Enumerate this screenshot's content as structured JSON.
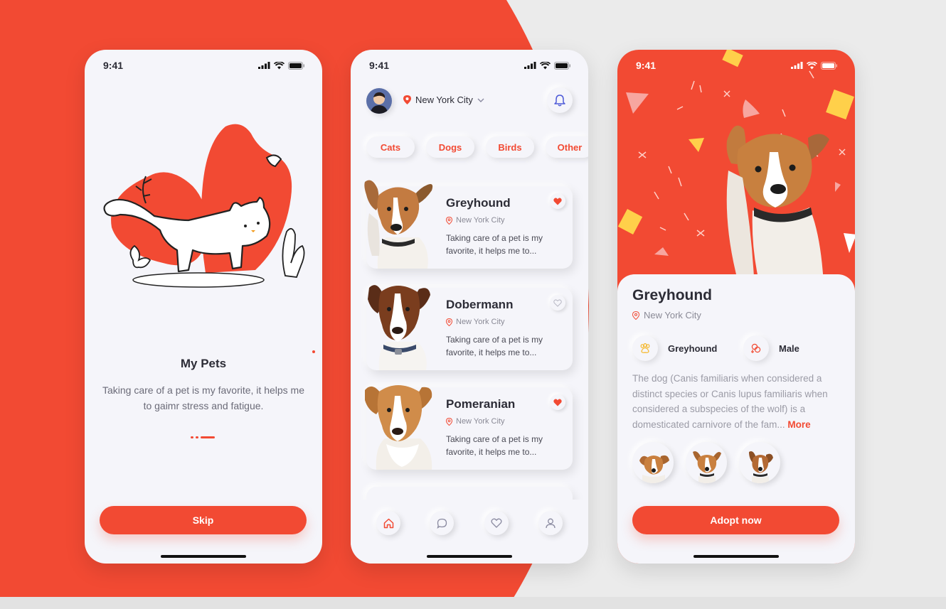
{
  "colors": {
    "accent": "#f24a33",
    "background": "#ebebeb",
    "phone_bg": "#f5f5fa",
    "confetti": "#ffd04a"
  },
  "onboarding": {
    "time": "9:41",
    "title": "My Pets",
    "text": "Taking care of a pet is my favorite, it helps me to gaimr stress and fatigue.",
    "skip_label": "Skip",
    "page_indicator": {
      "current": 3,
      "total": 3
    }
  },
  "home": {
    "time": "9:41",
    "location": "New York City",
    "categories": [
      "Cats",
      "Dogs",
      "Birds",
      "Other"
    ],
    "pets": [
      {
        "name": "Greyhound",
        "location": "New York City",
        "desc_line1": "Taking care of a pet is my",
        "desc_line2": "favorite, it helps me to...",
        "favorite": true
      },
      {
        "name": "Dobermann",
        "location": "New York City",
        "desc_line1": "Taking care of a pet is my",
        "desc_line2": "favorite, it helps me to...",
        "favorite": false
      },
      {
        "name": "Pomeranian",
        "location": "New York City",
        "desc_line1": "Taking care of a pet is my",
        "desc_line2": "favorite, it helps me to...",
        "favorite": true
      }
    ],
    "nav": [
      "home-icon",
      "chat-icon",
      "heart-icon",
      "user-icon"
    ]
  },
  "detail": {
    "time": "9:41",
    "name": "Greyhound",
    "location": "New York City",
    "breed": "Greyhound",
    "gender": "Male",
    "description": "The dog (Canis familiaris when considered a distinct species or Canis lupus familiaris when considered a subspecies of the wolf) is a domesticated carnivore of the fam...",
    "more_label": "More",
    "adopt_label": "Adopt now"
  }
}
